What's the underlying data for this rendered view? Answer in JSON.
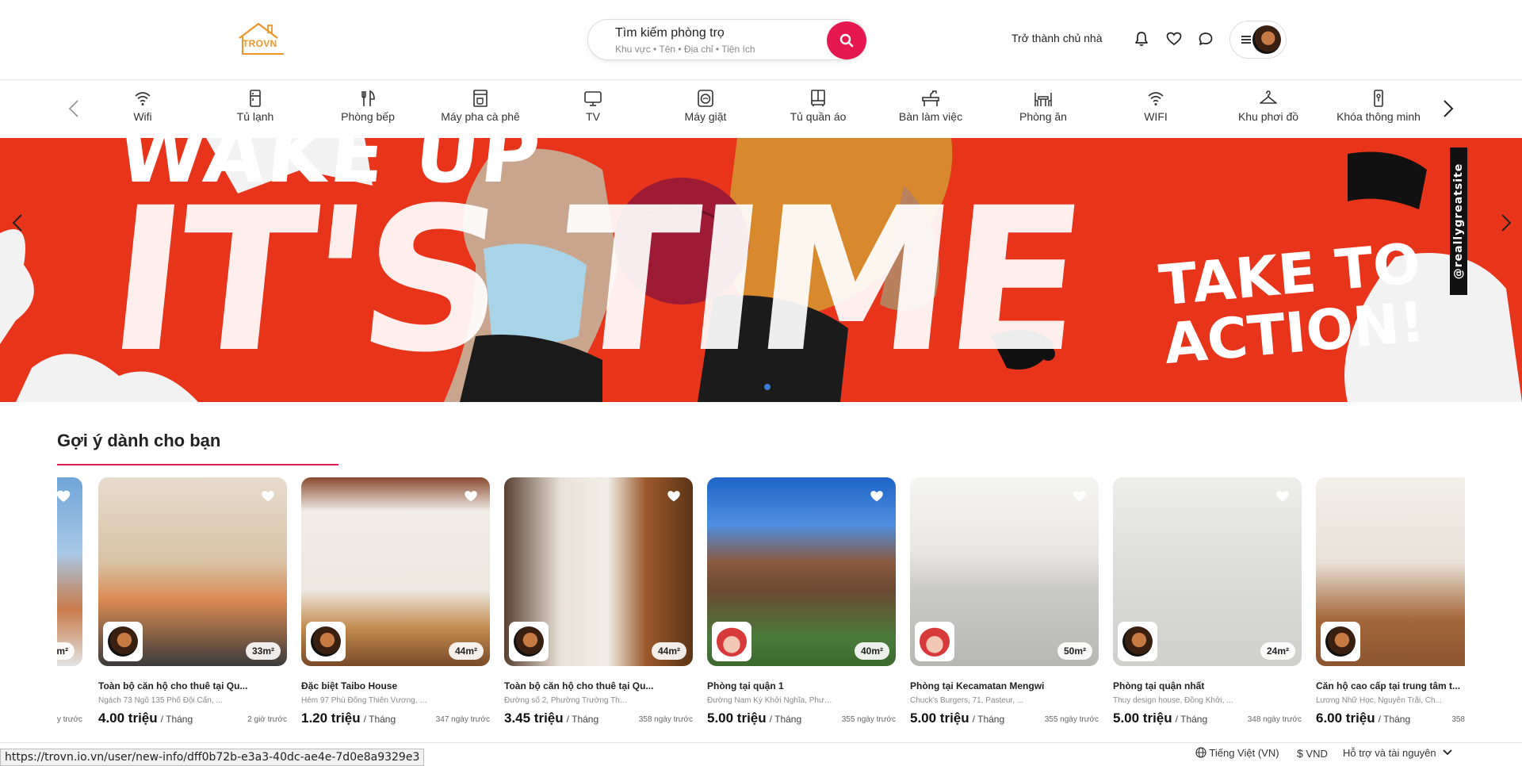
{
  "header": {
    "logo_text": "TROVN",
    "search_title": "Tìm kiếm phòng trọ",
    "search_subtitle": "Khu vực • Tên • Địa chỉ • Tiện ích",
    "become_host": "Trở thành chủ nhà",
    "icons": [
      "bell-icon",
      "heart-icon",
      "chat-icon",
      "menu-icon"
    ]
  },
  "categories": [
    {
      "label": "Wifi",
      "icon": "wifi-icon"
    },
    {
      "label": "Tủ lạnh",
      "icon": "fridge-icon"
    },
    {
      "label": "Phòng bếp",
      "icon": "kitchen-icon"
    },
    {
      "label": "Máy pha cà phê",
      "icon": "coffee-machine-icon"
    },
    {
      "label": "TV",
      "icon": "tv-icon"
    },
    {
      "label": "Máy giặt",
      "icon": "washing-machine-icon"
    },
    {
      "label": "Tủ quần áo",
      "icon": "wardrobe-icon"
    },
    {
      "label": "Bàn làm việc",
      "icon": "desk-icon"
    },
    {
      "label": "Phòng ăn",
      "icon": "dining-icon"
    },
    {
      "label": "WIFI",
      "icon": "wifi-icon"
    },
    {
      "label": "Khu phơi đồ",
      "icon": "hanger-icon"
    },
    {
      "label": "Khóa thông minh",
      "icon": "smart-lock-icon"
    }
  ],
  "banner": {
    "text_top": "WAKE UP",
    "text_big": "IT'S TIME",
    "text_action_1": "TAKE TO",
    "text_action_2": "ACTION!",
    "text_side": "@reallygreatsite",
    "brand_color": "#e8341a"
  },
  "section": {
    "title": "Gợi ý dành cho bạn"
  },
  "partial_card": {
    "area": "m²",
    "time": "y trước"
  },
  "cards": [
    {
      "title": "Toàn bộ căn hộ cho thuê tại Qu...",
      "address": "Ngách 73 Ngõ 135 Phố Đội Cấn, ...",
      "price": "4.00 triệu",
      "unit": "/ Tháng",
      "time": "2 giờ trước",
      "area": "33m²"
    },
    {
      "title": "Đặc biệt Taibo House",
      "address": "Hẻm 97 Phù Đổng Thiên Vương, C...",
      "price": "1.20 triệu",
      "unit": "/ Tháng",
      "time": "347 ngày trước",
      "area": "44m²"
    },
    {
      "title": "Toàn bộ căn hộ cho thuê tại Qu...",
      "address": "Đường số 2, Phường Trường Thọ,...",
      "price": "3.45 triệu",
      "unit": "/ Tháng",
      "time": "358 ngày trước",
      "area": "44m²"
    },
    {
      "title": "Phòng tại quận 1",
      "address": "Đường Nam Kỳ Khởi Nghĩa, Phườn...",
      "price": "5.00 triệu",
      "unit": "/ Tháng",
      "time": "355 ngày trước",
      "area": "40m²"
    },
    {
      "title": "Phòng tại Kecamatan Mengwi",
      "address": "Chuck's Burgers, 71, Pasteur, ...",
      "price": "5.00 triệu",
      "unit": "/ Tháng",
      "time": "355 ngày trước",
      "area": "50m²"
    },
    {
      "title": "Phòng tại quận nhất",
      "address": "Thuy design house, Đồng Khởi, ...",
      "price": "5.00 triệu",
      "unit": "/ Tháng",
      "time": "348 ngày trước",
      "area": "24m²"
    },
    {
      "title": "Căn hộ cao cấp tại trung tâm t...",
      "address": "Lương Nhữ Học, Nguyễn Trãi, Ch...",
      "price": "6.00 triệu",
      "unit": "/ Tháng",
      "time": "358",
      "area": ""
    }
  ],
  "footer": {
    "language": "Tiếng Việt (VN)",
    "currency": "VND",
    "support": "Hỗ trợ và tài nguyên"
  },
  "status_url": "https://trovn.io.vn/user/new-info/dff0b72b-e3a3-40dc-ae4e-7d0e8a9329e3"
}
